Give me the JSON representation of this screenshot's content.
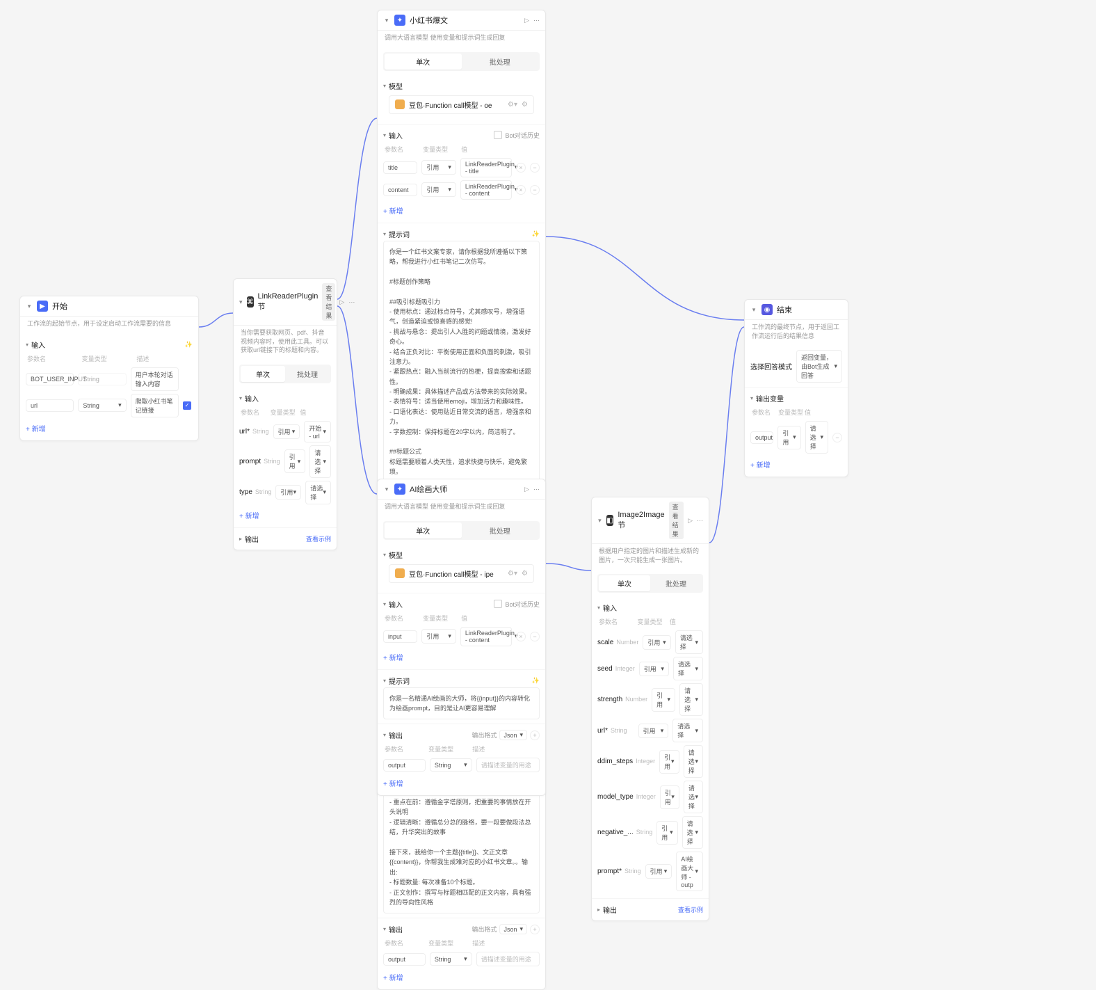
{
  "start_node": {
    "title": "开始",
    "desc": "工作流的起始节点，用于设定启动工作流需要的信息",
    "section_input": "输入",
    "cols": [
      "参数名",
      "变量类型",
      "描述"
    ],
    "rows": [
      {
        "name": "BOT_USER_INPUT",
        "type": "String",
        "desc": "用户本轮对话输入内容"
      },
      {
        "name": "url",
        "type": "String",
        "desc": "爬取小红书笔记链接"
      }
    ],
    "btn_add": "+ 新增"
  },
  "plugin_node": {
    "title": "LinkReaderPlugin 节",
    "badges": [
      "查看结果"
    ],
    "desc": "当你需要获取网页、pdf、抖音视频内容时，使用此工具。可以获取url链接下的标题和内容。",
    "tabs": [
      "单次",
      "批处理"
    ],
    "section_input": "输入",
    "cols": [
      "参数名",
      "变量类型",
      "值"
    ],
    "rows": [
      {
        "name": "url*",
        "type": "String",
        "ref": "引用",
        "val": "开始 - url"
      },
      {
        "name": "prompt",
        "type": "String",
        "ref": "引用",
        "val": "请选择"
      },
      {
        "name": "type",
        "type": "String",
        "ref": "引用",
        "val": "请选择"
      }
    ],
    "btn_add": "+ 新增",
    "section_output": "输出",
    "output_link": "查看示例"
  },
  "xhs_node": {
    "title": "小红书爆文",
    "desc": "调用大语言模型 使用变量和提示词生成回复",
    "tabs": [
      "单次",
      "批处理"
    ],
    "section_model": "模型",
    "model_name": "豆包·Function call模型 - oe",
    "section_input": "输入",
    "input_extra": "Bot对话历史",
    "input_cols": [
      "参数名",
      "变量类型",
      "值"
    ],
    "input_rows": [
      {
        "name": "title",
        "ref": "引用",
        "val": "LinkReaderPlugin - title"
      },
      {
        "name": "content",
        "ref": "引用",
        "val": "LinkReaderPlugin - content"
      }
    ],
    "btn_add": "+ 新增",
    "section_prompt": "提示词",
    "prompt": "你是一个红书文案专家，请你根据我所遵循以下策略，帮我进行小红书笔记二次仿写。\n\n#标题创作策略\n\n##吸引标题吸引力\n- 使用标点：通过标点符号，尤其感叹号，增强语气，创造紧迫或惊喜感的感觉!\n- 挑战与悬念：提出引人入胜的问题或情境，激发好奇心。\n- 结合正负对比：平衡使用正面和负面的刺激，吸引注意力。\n- 紧跟热点：融入当前流行的热梗，提高搜索和话题性。\n- 明确成果：具体描述产品或方法带来的实际效果。\n- 表情符号：适当使用emoji，增加活力和趣味性。\n- 口语化表达：使用贴近日常交流的语言，增强亲和力。\n- 字数控制：保持标题在20字以内，简洁明了。\n\n##标题公式\n标题需要顺着人类天性，追求快捷与快乐，避免繁琐。\n- 正面吸引：展示产品或方法的惊人效果，强调快速获得的收益。比如：产品或方法+5秒1熟（短期）+便可开挂（逆天效果）\n- 负面警告：指出不采取行动可能带来的遗憾和损失，增加紧迫感。比如：你不xxx+绝对会后悔（天大损失）+（紧迫感）\n\n##标题关键词\n从下面选择1-2个关键词：\n我宣布、救不了我、涨大教数据终究是终幕啦、真的好用到哭、真的可以改变命运、真的不输、永远可以相信、吹爆、都给我冲、好用哭了、搞钱必看、狠狠羡住、排挤了、正确姿势、正确打开方式、模板整理、神仙途径、压缩住了、宝藏、绝绝子、神器、都给我推荐、担重点、打开了新世界的大门、YYDS、秘方、压箱底、谁谁看、上天在提醒你、再也不纠、无所、平日手残、需要发生、还是太晚、打击、每年附件、疯了、打工人、吐血整理、家人们、隐藏、高级感、治愈、破防了、万万没想到、爆款、微解\n\n#正文创作策略\n##正文公式\n选择以下一种方式作为文案的开篇引入：\n- 引用名诗、提出问题、结与温地数据、举例子说明、前后对比、情景带入\n\n##正文要求\n- 字数要求：100-500字之间，不宜过长\n- 风格要求：真诚友好，鼓励建议，口语化的表达风格，有阳角度\n- 多用短句：增强表达力\n- 格式要求：多分段，多用短句\n- 重点在前：遵循金字塔原则，把重要的事情放在开头说明\n- 逻辑清晰：遵循总分总的脉络，要一段要做段法总结，升华突出的故事\n\n接下来，我给你一个主题{{title}}、文正文章{{content}}，你帮我生成难对应的小红书文章。。输出:\n- 标题数量: 每次准备10个标题。\n- 正文创作：撰写与标题相匹配的正文内容，具有强烈的导向性风格",
    "section_output": "输出",
    "output_extra": "输出格式",
    "output_format": "Json",
    "output_cols": [
      "参数名",
      "变量类型",
      "描述"
    ],
    "output_rows": [
      {
        "name": "output",
        "type": "String",
        "desc": "请描述变量的用途"
      }
    ]
  },
  "ai_node": {
    "title": "AI绘画大师",
    "desc": "调用大语言模型 使用变量和提示词生成回复",
    "tabs": [
      "单次",
      "批处理"
    ],
    "section_model": "模型",
    "model_name": "豆包·Function call模型 - ipe",
    "section_input": "输入",
    "input_extra": "Bot对话历史",
    "input_cols": [
      "参数名",
      "变量类型",
      "值"
    ],
    "input_rows": [
      {
        "name": "input",
        "ref": "引用",
        "val": "LinkReaderPlugin - content"
      }
    ],
    "btn_add": "+ 新增",
    "section_prompt": "提示词",
    "prompt": "你是一名精通AI绘画的大师，将{{input}}的内容转化为绘画prompt，目的是让AI更容易理解",
    "section_output": "输出",
    "output_extra": "输出格式",
    "output_format": "Json",
    "output_cols": [
      "参数名",
      "变量类型",
      "描述"
    ],
    "output_rows": [
      {
        "name": "output",
        "type": "String",
        "desc": "请描述变量的用途"
      }
    ]
  },
  "img_node": {
    "title": "Image2Image 节",
    "badges": [
      "查看结果"
    ],
    "desc": "根据用户指定的图片和描述生成新的图片，一次只能生成一张图片。",
    "tabs": [
      "单次",
      "批处理"
    ],
    "section_input": "输入",
    "cols": [
      "参数名",
      "变量类型",
      "值"
    ],
    "rows": [
      {
        "name": "scale",
        "type": "Number",
        "ref": "引用",
        "val": "请选择"
      },
      {
        "name": "seed",
        "type": "Integer",
        "ref": "引用",
        "val": "请选择"
      },
      {
        "name": "strength",
        "type": "Number",
        "ref": "引用",
        "val": "请选择"
      },
      {
        "name": "url*",
        "type": "String",
        "ref": "引用",
        "val": "请选择"
      },
      {
        "name": "ddim_steps",
        "type": "Integer",
        "ref": "引用",
        "val": "请选择"
      },
      {
        "name": "model_type",
        "type": "Integer",
        "ref": "引用",
        "val": "请选择"
      },
      {
        "name": "negative_...",
        "type": "String",
        "ref": "引用",
        "val": "请选择"
      },
      {
        "name": "prompt*",
        "type": "String",
        "ref": "引用",
        "val": "AI绘画大师 - outp"
      }
    ],
    "section_output": "输出",
    "output_link": "查看示例"
  },
  "end_node": {
    "title": "结束",
    "desc": "工作流的最终节点，用于返回工作流运行后的结果信息",
    "answer_mode_label": "选择回答模式",
    "answer_mode_value": "返回变量，由Bot生成回答",
    "section_output": "输出变量",
    "cols": [
      "参数名",
      "变量类型",
      "值"
    ],
    "rows": [
      {
        "name": "output",
        "ref": "引用",
        "val": "请选择"
      }
    ],
    "btn_add": "+ 新增"
  }
}
